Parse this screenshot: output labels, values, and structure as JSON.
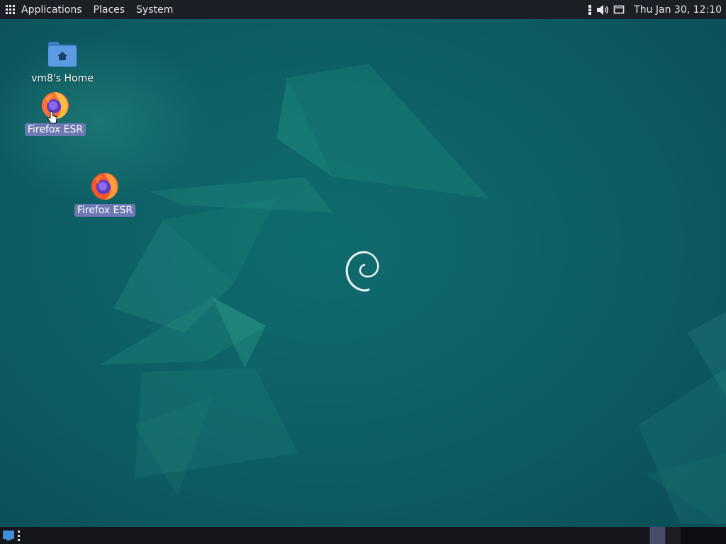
{
  "top_panel": {
    "menu": {
      "applications": "Applications",
      "places": "Places",
      "system": "System"
    },
    "tray": {
      "icons": [
        "network-icon",
        "volume-icon",
        "display-icon"
      ]
    },
    "clock": "Thu Jan 30, 12:10"
  },
  "desktop": {
    "icons": [
      {
        "label": "vm8's Home",
        "icon": "home-folder-icon",
        "selected": false
      },
      {
        "label": "Firefox ESR",
        "icon": "firefox-icon",
        "selected": true
      },
      {
        "label": "Firefox ESR",
        "icon": "firefox-icon",
        "selected": true
      }
    ]
  },
  "colors": {
    "panel_bg": "#1c1f26",
    "wallpaper_base": "#0e5c63",
    "selection": "#6e78b2"
  }
}
